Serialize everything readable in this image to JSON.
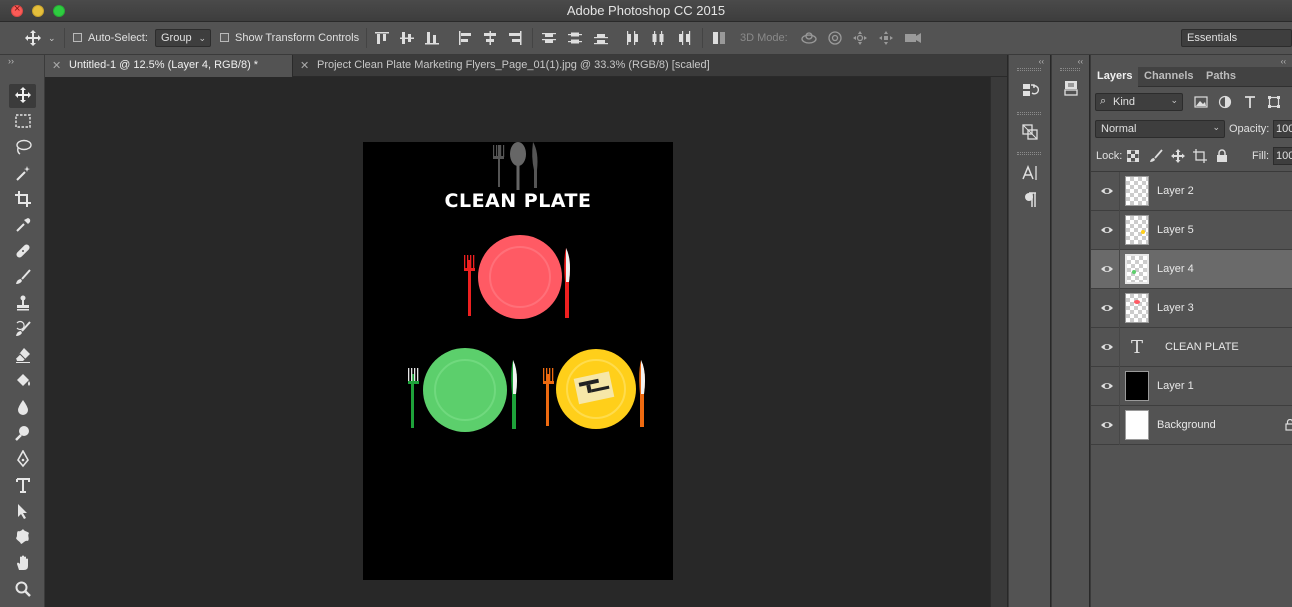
{
  "window": {
    "title": "Adobe Photoshop CC 2015"
  },
  "options_bar": {
    "auto_select_label": "Auto-Select:",
    "auto_select_target": "Group",
    "show_transform_label": "Show Transform Controls",
    "mode_3d_label": "3D Mode:",
    "workspace": "Essentials"
  },
  "documents": {
    "tabs": [
      {
        "label": "Untitled-1 @ 12.5% (Layer 4, RGB/8) *",
        "active": true
      },
      {
        "label": "Project Clean Plate Marketing Flyers_Page_01(1).jpg @ 33.3% (RGB/8) [scaled]",
        "active": false
      }
    ]
  },
  "artboard": {
    "title": "CLEAN PLATE",
    "plate_colors": {
      "red": "#ff5a64",
      "green": "#5ccf6c",
      "yellow": "#ffcf1a"
    }
  },
  "tools": [
    {
      "name": "move-tool",
      "icon": "move-icon",
      "active": true
    },
    {
      "name": "marquee-tool",
      "icon": "marquee-icon"
    },
    {
      "name": "lasso-tool",
      "icon": "lasso-icon"
    },
    {
      "name": "magic-wand-tool",
      "icon": "magic-wand-icon"
    },
    {
      "name": "crop-tool",
      "icon": "crop-icon"
    },
    {
      "name": "eyedropper-tool",
      "icon": "eyedropper-icon"
    },
    {
      "name": "healing-brush-tool",
      "icon": "bandage-icon"
    },
    {
      "name": "brush-tool",
      "icon": "brush-icon"
    },
    {
      "name": "clone-stamp-tool",
      "icon": "stamp-icon"
    },
    {
      "name": "history-brush-tool",
      "icon": "history-brush-icon"
    },
    {
      "name": "eraser-tool",
      "icon": "eraser-icon"
    },
    {
      "name": "paint-bucket-tool",
      "icon": "bucket-icon"
    },
    {
      "name": "blur-tool",
      "icon": "drop-icon"
    },
    {
      "name": "dodge-tool",
      "icon": "dodge-icon"
    },
    {
      "name": "pen-tool",
      "icon": "pen-icon"
    },
    {
      "name": "type-tool",
      "icon": "type-icon"
    },
    {
      "name": "path-selection-tool",
      "icon": "arrow-icon"
    },
    {
      "name": "custom-shape-tool",
      "icon": "shape-icon"
    },
    {
      "name": "hand-tool",
      "icon": "hand-icon"
    },
    {
      "name": "zoom-tool",
      "icon": "zoom-icon"
    }
  ],
  "layers_panel": {
    "tabs": [
      "Layers",
      "Channels",
      "Paths"
    ],
    "filter_label": "Kind",
    "blend_mode": "Normal",
    "opacity_label": "Opacity:",
    "opacity_value": "100",
    "lock_label": "Lock:",
    "fill_label": "Fill:",
    "fill_value": "100",
    "layers": [
      {
        "name": "Layer 2",
        "thumb": "checker",
        "selected": false
      },
      {
        "name": "Layer 5",
        "thumb": "checker",
        "selected": false
      },
      {
        "name": "Layer 4",
        "thumb": "checker",
        "selected": true
      },
      {
        "name": "Layer 3",
        "thumb": "checker",
        "selected": false
      },
      {
        "name": "CLEAN PLATE",
        "thumb": "text",
        "selected": false
      },
      {
        "name": "Layer 1",
        "thumb": "black",
        "selected": false
      },
      {
        "name": "Background",
        "thumb": "white",
        "selected": false,
        "locked": true
      }
    ]
  }
}
